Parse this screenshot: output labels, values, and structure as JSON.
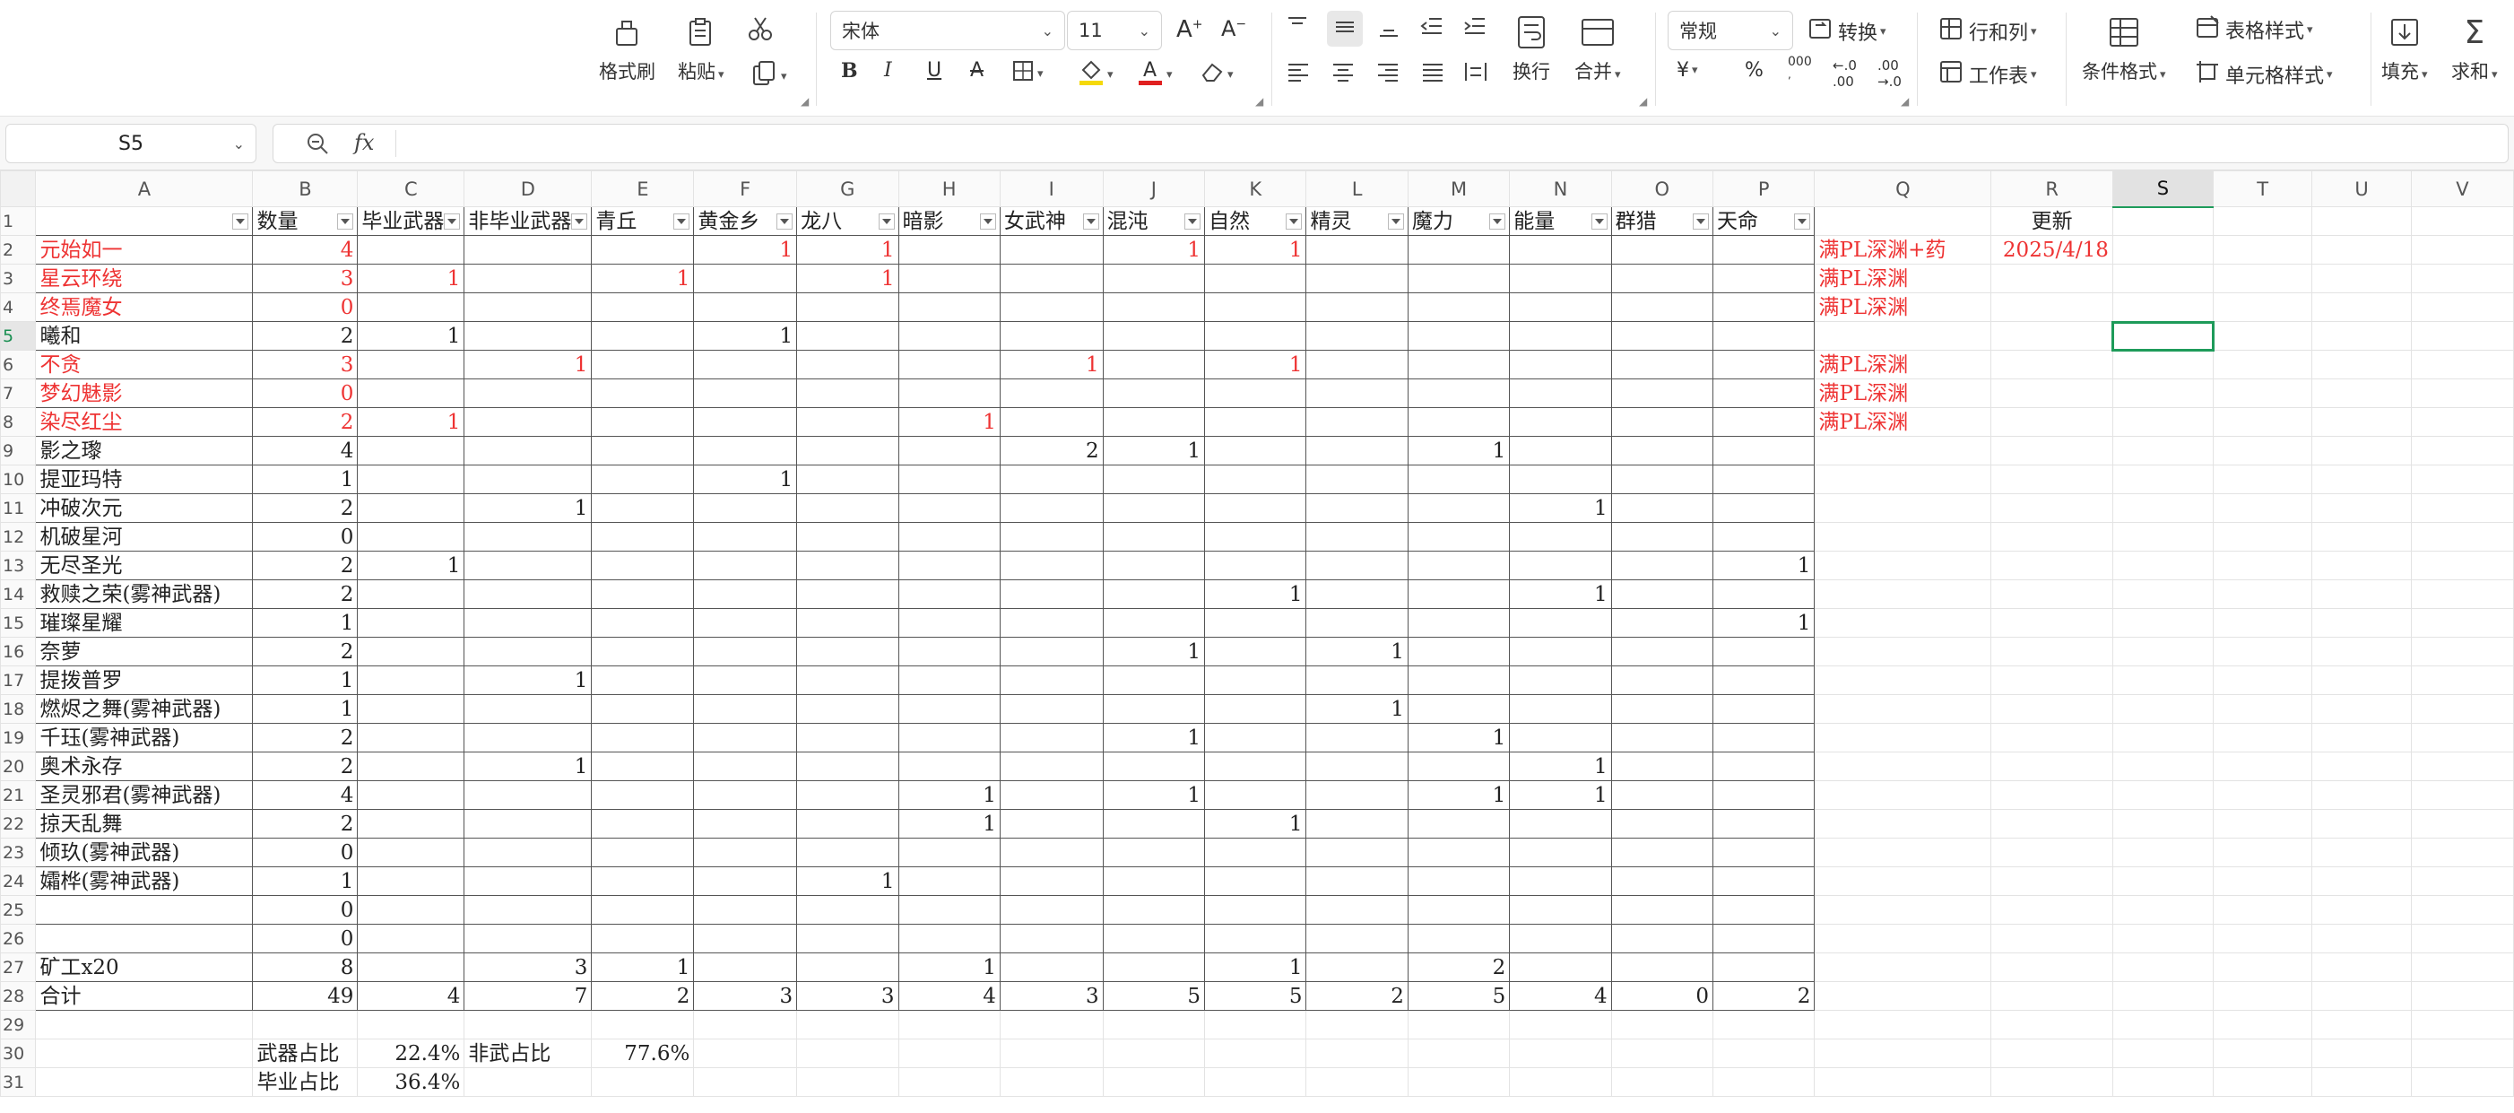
{
  "ribbon": {
    "clipboard": {
      "format_painter": "格式刷",
      "paste": "粘贴"
    },
    "font": {
      "name": "宋体",
      "size": "11"
    },
    "number_format": "常规",
    "convert": "转换",
    "rows_cols": "行和列",
    "table_style": "表格样式",
    "worksheet": "工作表",
    "wrap": "换行",
    "merge": "合并",
    "conditional_format": "条件格式",
    "cell_style": "单元格样式",
    "fill": "填充",
    "sum": "求和",
    "currency_symbol": "¥",
    "percent_symbol": "%",
    "thousands_symbol": "000"
  },
  "formula_bar": {
    "name_box": "S5",
    "fx": "fx",
    "value": ""
  },
  "columns": [
    "A",
    "B",
    "C",
    "D",
    "E",
    "F",
    "G",
    "H",
    "I",
    "J",
    "K",
    "L",
    "M",
    "N",
    "O",
    "P",
    "Q",
    "R",
    "S",
    "T",
    "U",
    "V"
  ],
  "active_column": "S",
  "active_row": 5,
  "header_row": {
    "A": "",
    "B": "数量",
    "C": "毕业武器",
    "D": "非毕业武器",
    "E": "青丘",
    "F": "黄金乡",
    "G": "龙八",
    "H": "暗影",
    "I": "女武神",
    "J": "混沌",
    "K": "自然",
    "L": "精灵",
    "M": "魔力",
    "N": "能量",
    "O": "群猎",
    "P": "天命",
    "Q": "",
    "R": "更新"
  },
  "rows": [
    {
      "r": 2,
      "A": "元始如一",
      "red": true,
      "B": "4",
      "F": "1",
      "G": "1",
      "J": "1",
      "K": "1",
      "Q": "满PL深渊+药",
      "R": "2025/4/18"
    },
    {
      "r": 3,
      "A": "星云环绕",
      "red": true,
      "B": "3",
      "C": "1",
      "E": "1",
      "G": "1",
      "Q": "满PL深渊"
    },
    {
      "r": 4,
      "A": "终焉魔女",
      "red": true,
      "B": "0",
      "Q": "满PL深渊"
    },
    {
      "r": 5,
      "A": "曦和",
      "B": "2",
      "C": "1",
      "F": "1"
    },
    {
      "r": 6,
      "A": "不贪",
      "red": true,
      "B": "3",
      "D": "1",
      "I": "1",
      "K": "1",
      "Q": "满PL深渊"
    },
    {
      "r": 7,
      "A": "梦幻魅影",
      "red": true,
      "B": "0",
      "Q": "满PL深渊"
    },
    {
      "r": 8,
      "A": "染尽红尘",
      "red": true,
      "B": "2",
      "C": "1",
      "H": "1",
      "Q": "满PL深渊"
    },
    {
      "r": 9,
      "A": "影之瓈",
      "B": "4",
      "I": "2",
      "J": "1",
      "M": "1"
    },
    {
      "r": 10,
      "A": "提亚玛特",
      "B": "1",
      "F": "1"
    },
    {
      "r": 11,
      "A": "冲破次元",
      "B": "2",
      "D": "1",
      "N": "1"
    },
    {
      "r": 12,
      "A": "机破星河",
      "B": "0"
    },
    {
      "r": 13,
      "A": "无尽圣光",
      "B": "2",
      "C": "1",
      "P": "1"
    },
    {
      "r": 14,
      "A": "救赎之荣(雾神武器)",
      "B": "2",
      "K": "1",
      "N": "1"
    },
    {
      "r": 15,
      "A": "璀璨星耀",
      "B": "1",
      "P": "1"
    },
    {
      "r": 16,
      "A": "奈萝",
      "B": "2",
      "J": "1",
      "L": "1"
    },
    {
      "r": 17,
      "A": "提拨普罗",
      "B": "1",
      "D": "1"
    },
    {
      "r": 18,
      "A": "燃烬之舞(雾神武器)",
      "B": "1",
      "L": "1"
    },
    {
      "r": 19,
      "A": "千珏(雾神武器)",
      "B": "2",
      "J": "1",
      "M": "1"
    },
    {
      "r": 20,
      "A": "奥术永存",
      "B": "2",
      "D": "1",
      "N": "1"
    },
    {
      "r": 21,
      "A": "圣灵邪君(雾神武器)",
      "B": "4",
      "H": "1",
      "J": "1",
      "M": "1",
      "N": "1"
    },
    {
      "r": 22,
      "A": "掠天乱舞",
      "B": "2",
      "H": "1",
      "K": "1"
    },
    {
      "r": 23,
      "A": "倾玖(雾神武器)",
      "B": "0"
    },
    {
      "r": 24,
      "A": "孀桦(雾神武器)",
      "B": "1",
      "G": "1"
    },
    {
      "r": 25,
      "A": "",
      "B": "0"
    },
    {
      "r": 26,
      "A": "",
      "B": "0"
    },
    {
      "r": 27,
      "A": "矿工x20",
      "B": "8",
      "D": "3",
      "E": "1",
      "H": "1",
      "K": "1",
      "M": "2"
    },
    {
      "r": 28,
      "A": "合计",
      "B": "49",
      "C": "4",
      "D": "7",
      "E": "2",
      "F": "3",
      "G": "3",
      "H": "4",
      "I": "3",
      "J": "5",
      "K": "5",
      "L": "2",
      "M": "5",
      "N": "4",
      "O": "0",
      "P": "2"
    },
    {
      "r": 29
    },
    {
      "r": 30,
      "B": "武器占比",
      "C": "22.4%",
      "D": "非武占比",
      "E": "77.6%"
    },
    {
      "r": 31,
      "B": "毕业占比",
      "C": "36.4%"
    }
  ],
  "colors": {
    "accent_green": "#1e9b5a",
    "red_text": "#e33333"
  }
}
